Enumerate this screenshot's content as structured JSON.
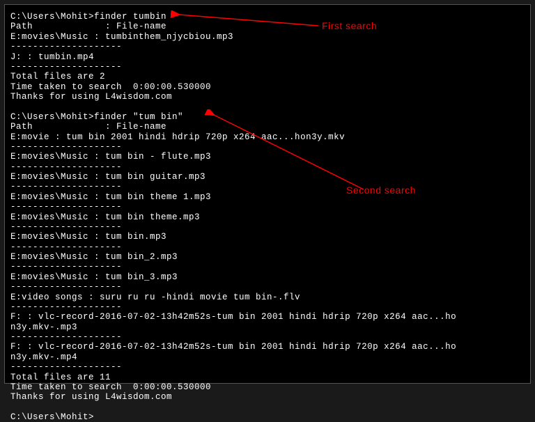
{
  "terminal": {
    "lines": [
      "C:\\Users\\Mohit>finder tumbin",
      "Path             : File-name",
      "E:movies\\Music : tumbinthem_njycbiou.mp3",
      "--------------------",
      "J: : tumbin.mp4",
      "--------------------",
      "Total files are 2",
      "Time taken to search  0:00:00.530000",
      "Thanks for using L4wisdom.com",
      "",
      "C:\\Users\\Mohit>finder \"tum bin\"",
      "Path             : File-name",
      "E:movie : tum bin 2001 hindi hdrip 720p x264 aac...hon3y.mkv",
      "--------------------",
      "E:movies\\Music : tum bin - flute.mp3",
      "--------------------",
      "E:movies\\Music : tum bin guitar.mp3",
      "--------------------",
      "E:movies\\Music : tum bin theme 1.mp3",
      "--------------------",
      "E:movies\\Music : tum bin theme.mp3",
      "--------------------",
      "E:movies\\Music : tum bin.mp3",
      "--------------------",
      "E:movies\\Music : tum bin_2.mp3",
      "--------------------",
      "E:movies\\Music : tum bin_3.mp3",
      "--------------------",
      "E:video songs : suru ru ru -hindi movie tum bin-.flv",
      "--------------------",
      "F: : vlc-record-2016-07-02-13h42m52s-tum bin 2001 hindi hdrip 720p x264 aac...ho",
      "n3y.mkv-.mp3",
      "--------------------",
      "F: : vlc-record-2016-07-02-13h42m52s-tum bin 2001 hindi hdrip 720p x264 aac...ho",
      "n3y.mkv-.mp4",
      "--------------------",
      "Total files are 11",
      "Time taken to search  0:00:00.530000",
      "Thanks for using L4wisdom.com",
      "",
      "C:\\Users\\Mohit>"
    ]
  },
  "annotations": {
    "first_search": "First search",
    "second_search": "Second search"
  }
}
